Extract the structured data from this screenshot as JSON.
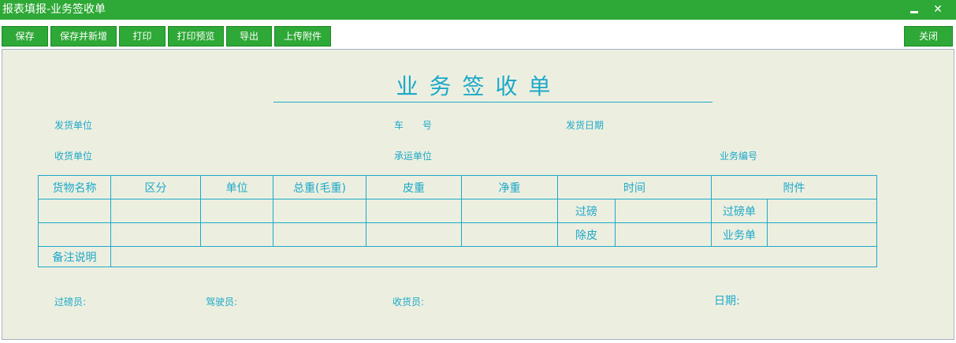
{
  "window": {
    "title": "报表填报-业务签收单",
    "close_glyph": "✕"
  },
  "toolbar": {
    "save": "保存",
    "save_new": "保存并新增",
    "print": "打印",
    "print_preview": "打印预览",
    "export": "导出",
    "upload": "上传附件",
    "close": "关闭"
  },
  "form": {
    "title": "业务签收单",
    "labels": {
      "shipper": "发货单位",
      "car_no": "车　　号",
      "ship_date": "发货日期",
      "receiver": "收货单位",
      "carrier": "承运单位",
      "biz_no": "业务编号"
    }
  },
  "table": {
    "headers": {
      "goods": "货物名称",
      "zone": "区分",
      "unit": "单位",
      "gross": "总重(毛重)",
      "tare": "皮重",
      "net": "净重",
      "time": "时间",
      "attach": "附件"
    },
    "rows": {
      "weigh": "过磅",
      "weigh_slip": "过磅单",
      "tare_off": "除皮",
      "biz_slip": "业务单"
    },
    "remark": "备注说明"
  },
  "footer": {
    "weigher": "过磅员:",
    "driver": "驾驶员:",
    "consignee": "收货员:",
    "date": "日期:"
  }
}
